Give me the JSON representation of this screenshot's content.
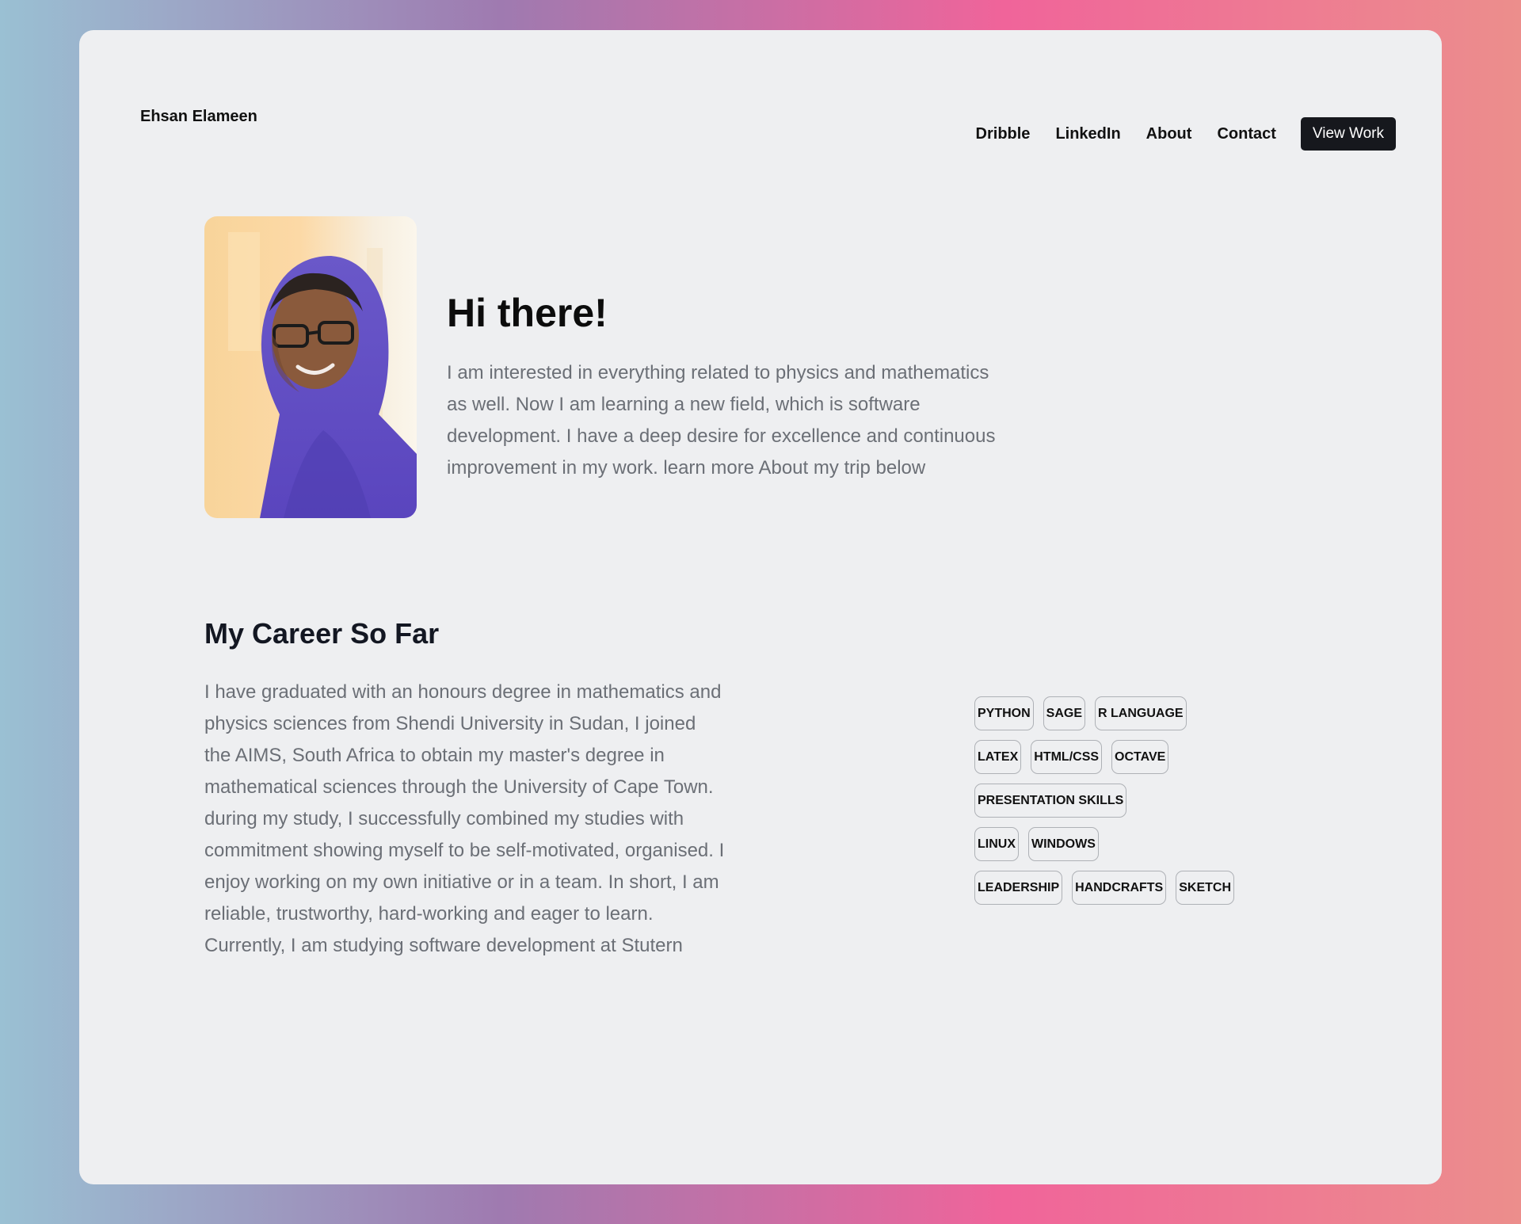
{
  "header": {
    "brand": "Ehsan Elameen",
    "nav": [
      "Dribble",
      "LinkedIn",
      "About",
      "Contact"
    ],
    "cta": "View Work"
  },
  "hero": {
    "title": "Hi there!",
    "text": "I am interested in everything related to physics and mathematics as well. Now I am learning a new field, which is software development. I have a deep desire for excellence and continuous improvement in my work. learn more About my trip below"
  },
  "career": {
    "title": "My Career So Far",
    "text": "I have graduated with an honours degree in mathematics and physics sciences from Shendi University in Sudan, I joined the AIMS, South Africa to obtain my master's degree in mathematical sciences through the University of Cape Town. during my study, I successfully combined my studies with commitment showing myself to be self-motivated, organised. I enjoy working on my own initiative or in a team. In short, I am reliable, trustworthy, hard-working and eager to learn. Currently, I am studying software development at Stutern"
  },
  "skills": [
    [
      "PYTHON",
      "SAGE",
      "R LANGUAGE"
    ],
    [
      "LATEX",
      "HTML/CSS",
      "OCTAVE"
    ],
    [
      "PRESENTATION SKILLS"
    ],
    [
      "LINUX",
      "WINDOWS"
    ],
    [
      "LEADERSHIP",
      "HANDCRAFTS",
      "SKETCH"
    ]
  ],
  "colors": {
    "card_background": "#eeeff1",
    "button_background": "#16181d",
    "body_text": "#6b6f76",
    "gradient": [
      "#9ac0d3",
      "#9f7ab0",
      "#f0649a",
      "#ec8e8c"
    ]
  }
}
